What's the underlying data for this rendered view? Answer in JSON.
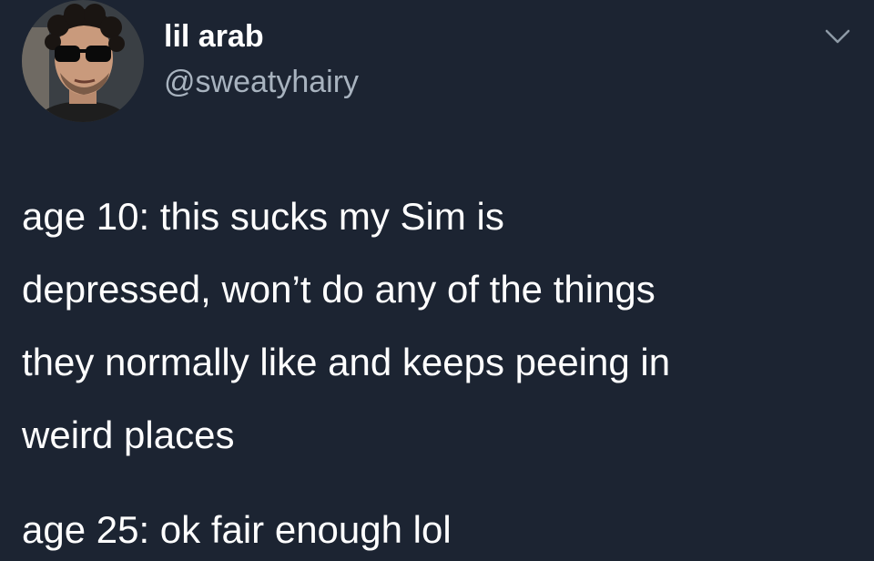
{
  "tweet": {
    "author": {
      "display_name": "lil arab",
      "handle": "@sweatyhairy"
    },
    "menu_icon": "chevron-down-icon",
    "text_lines": [
      "age 10: this sucks my Sim is",
      "depressed, won’t do any of the things",
      "they normally like and keeps peeing in",
      "weird places"
    ],
    "text_second": "age 25: ok fair enough lol"
  },
  "colors": {
    "background": "#1c2432",
    "text": "#ffffff",
    "handle": "#a8b3bf"
  }
}
